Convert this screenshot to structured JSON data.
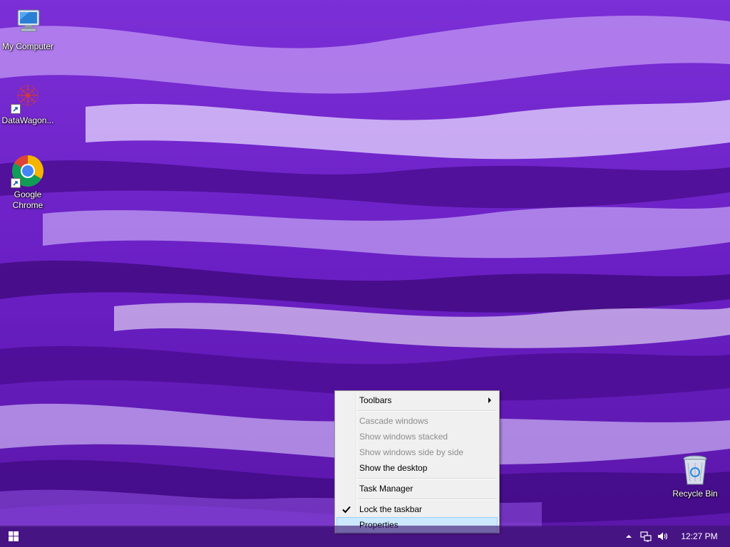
{
  "desktop": {
    "icons": [
      {
        "label": "My Computer",
        "icon": "computer-icon"
      },
      {
        "label": "DataWagon...",
        "icon": "datawagon-icon"
      },
      {
        "label": "Google Chrome",
        "icon": "chrome-icon"
      },
      {
        "label": "Recycle Bin",
        "icon": "recycle-bin-icon"
      }
    ]
  },
  "context_menu": {
    "items": {
      "toolbars": "Toolbars",
      "cascade": "Cascade windows",
      "stacked": "Show windows stacked",
      "side_by_side": "Show windows side by side",
      "show_desktop": "Show the desktop",
      "task_manager": "Task Manager",
      "lock_taskbar": "Lock the taskbar",
      "properties": "Properties"
    },
    "disabled": [
      "Cascade windows",
      "Show windows stacked",
      "Show windows side by side"
    ],
    "checked": "Lock the taskbar",
    "highlighted": "Properties"
  },
  "taskbar": {
    "clock": "12:27 PM",
    "tray_icons": [
      "chevron-up-icon",
      "network-icon",
      "volume-icon"
    ]
  },
  "colors": {
    "wallpaper": "#6a1fc4",
    "menu_background": "#f0f0f0",
    "menu_highlight": "#cce8ff",
    "disabled_text": "#8d8d8d"
  }
}
